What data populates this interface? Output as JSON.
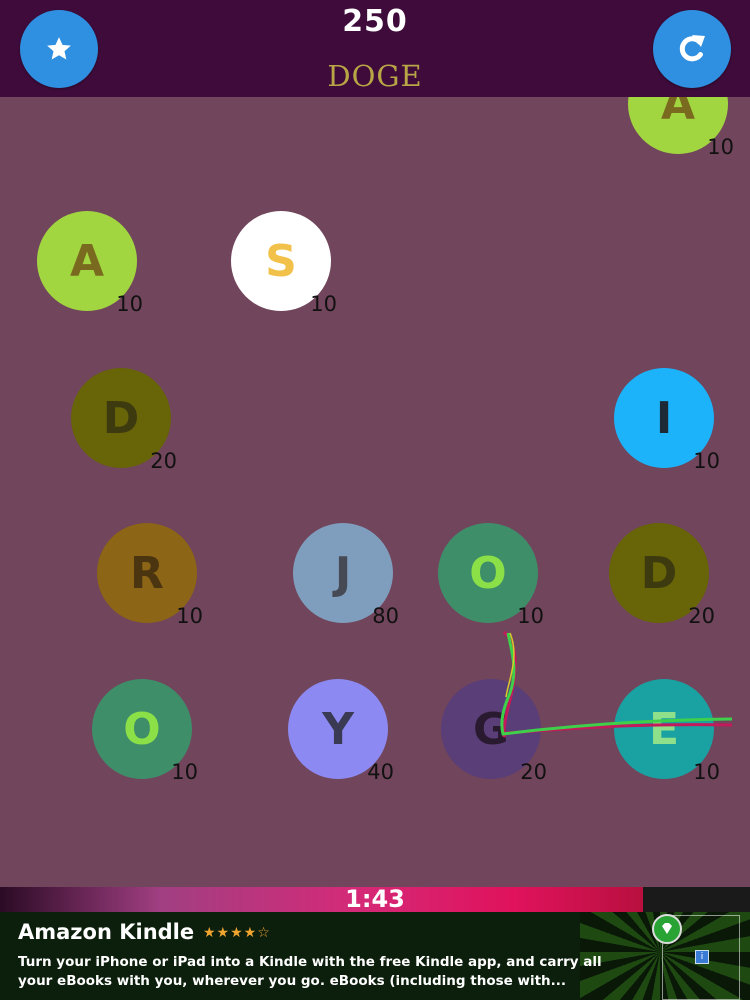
{
  "header": {
    "score": "250",
    "current_word": "DOGE",
    "star_icon": "star-icon",
    "restart_icon": "restart-icon"
  },
  "tiles": [
    {
      "letter": "A",
      "points": "10",
      "color": "#a2d641",
      "text_color": "#7a6a1f"
    },
    {
      "letter": "A",
      "points": "10",
      "color": "#a2d641",
      "text_color": "#7a6a1f"
    },
    {
      "letter": "S",
      "points": "10",
      "color": "#ffffff",
      "text_color": "#f2c14a"
    },
    {
      "letter": "D",
      "points": "20",
      "color": "#686408",
      "text_color": "#3d3a10"
    },
    {
      "letter": "I",
      "points": "10",
      "color": "#1cb3fa",
      "text_color": "#1d2a35"
    },
    {
      "letter": "R",
      "points": "10",
      "color": "#8c6516",
      "text_color": "#4a3510"
    },
    {
      "letter": "J",
      "points": "80",
      "color": "#7f9ebd",
      "text_color": "#454a55"
    },
    {
      "letter": "O",
      "points": "10",
      "color": "#3f8e6a",
      "text_color": "#8be047"
    },
    {
      "letter": "D",
      "points": "20",
      "color": "#686408",
      "text_color": "#3d3a10"
    },
    {
      "letter": "O",
      "points": "10",
      "color": "#3f8e6a",
      "text_color": "#8be047"
    },
    {
      "letter": "Y",
      "points": "40",
      "color": "#8c8af2",
      "text_color": "#3a3a55"
    },
    {
      "letter": "G",
      "points": "20",
      "color": "#5a3e78",
      "text_color": "#2a1a30"
    },
    {
      "letter": "E",
      "points": "10",
      "color": "#1aa2a2",
      "text_color": "#8fe08a"
    }
  ],
  "timer": "1:43",
  "ad": {
    "title": "Amazon Kindle",
    "rating": "★★★★☆",
    "description": "Turn your iPhone or iPad into a Kindle with the free Kindle app, and carry all your eBooks with you, wherever you go. eBooks (including those with...",
    "info_label": "i",
    "badge_icon": "diamond-icon"
  }
}
